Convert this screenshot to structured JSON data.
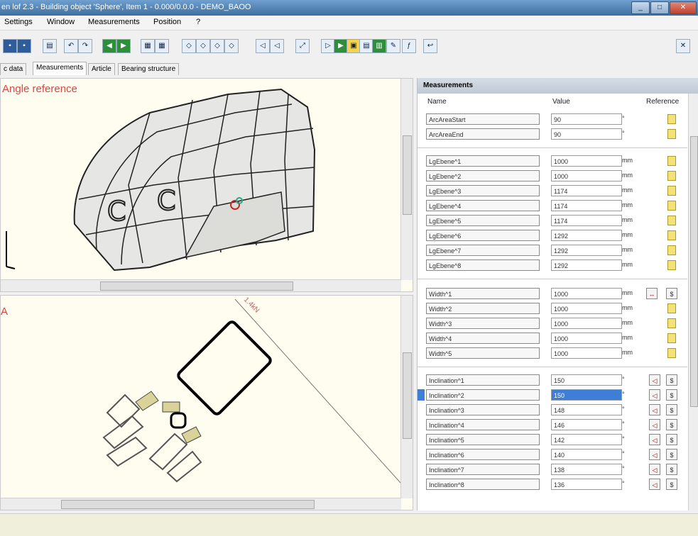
{
  "window": {
    "title": "en lof 2.3 - Building object 'Sphere', Item 1 - 0.000/0.0.0 - DEMO_BAOO",
    "min": "_",
    "max": "□",
    "close": "✕"
  },
  "menu": [
    "Settings",
    "Window",
    "Measurements",
    "Position",
    "?"
  ],
  "toolbar": {
    "close_label": "✕"
  },
  "tabs": [
    "c data",
    "Measurements",
    "Article",
    "Bearing structure"
  ],
  "viewports": {
    "top_label": "Angle reference",
    "bottom_label": "A",
    "bottom_annotation": "1.4kN"
  },
  "measurements": {
    "title": "Measurements",
    "col_name": "Name",
    "col_value": "Value",
    "col_reference": "Reference",
    "groups": [
      {
        "rows": [
          {
            "name": "ArcAreaStart",
            "value": "90",
            "unit": "°"
          },
          {
            "name": "ArcAreaEnd",
            "value": "90",
            "unit": "°"
          }
        ]
      },
      {
        "rows": [
          {
            "name": "LgEbene^1",
            "value": "1000",
            "unit": "mm"
          },
          {
            "name": "LgEbene^2",
            "value": "1000",
            "unit": "mm"
          },
          {
            "name": "LgEbene^3",
            "value": "1174",
            "unit": "mm"
          },
          {
            "name": "LgEbene^4",
            "value": "1174",
            "unit": "mm"
          },
          {
            "name": "LgEbene^5",
            "value": "1174",
            "unit": "mm"
          },
          {
            "name": "LgEbene^6",
            "value": "1292",
            "unit": "mm"
          },
          {
            "name": "LgEbene^7",
            "value": "1292",
            "unit": "mm"
          },
          {
            "name": "LgEbene^8",
            "value": "1292",
            "unit": "mm"
          }
        ]
      },
      {
        "rows": [
          {
            "name": "Width^1",
            "value": "1000",
            "unit": "mm"
          },
          {
            "name": "Width^2",
            "value": "1000",
            "unit": "mm"
          },
          {
            "name": "Width^3",
            "value": "1000",
            "unit": "mm"
          },
          {
            "name": "Width^4",
            "value": "1000",
            "unit": "mm"
          },
          {
            "name": "Width^5",
            "value": "1000",
            "unit": "mm"
          }
        ]
      },
      {
        "rows": [
          {
            "name": "Inclination^1",
            "value": "150",
            "unit": "°"
          },
          {
            "name": "Inclination^2",
            "value": "150",
            "unit": "°"
          },
          {
            "name": "Inclination^3",
            "value": "148",
            "unit": "°"
          },
          {
            "name": "Inclination^4",
            "value": "146",
            "unit": "°"
          },
          {
            "name": "Inclination^5",
            "value": "142",
            "unit": "°"
          },
          {
            "name": "Inclination^6",
            "value": "140",
            "unit": "°"
          },
          {
            "name": "Inclination^7",
            "value": "138",
            "unit": "°"
          },
          {
            "name": "Inclination^8",
            "value": "136",
            "unit": "°"
          }
        ]
      }
    ]
  }
}
